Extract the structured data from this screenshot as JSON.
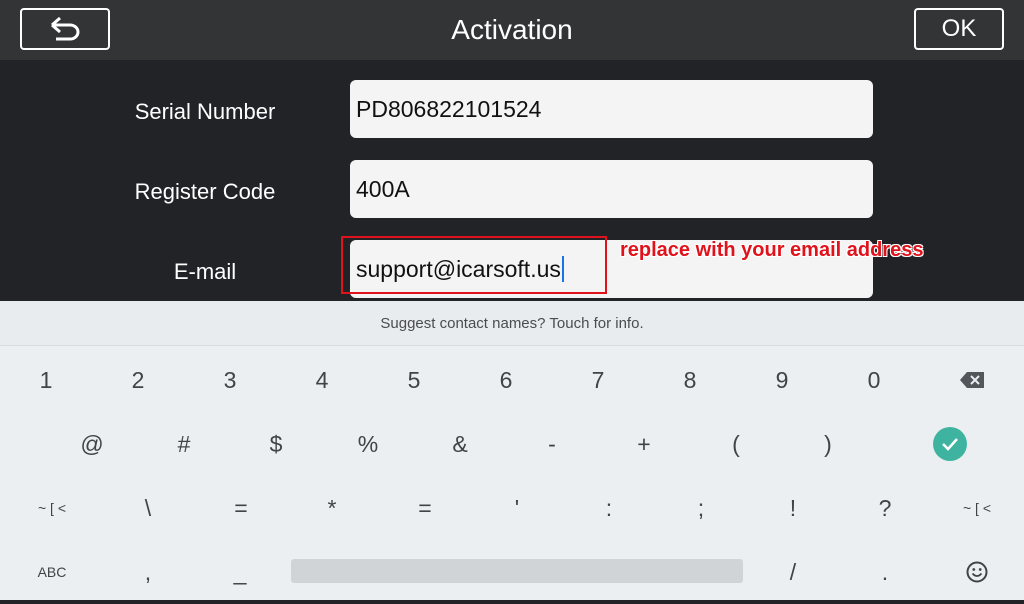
{
  "header": {
    "title": "Activation",
    "ok_label": "OK",
    "back_icon": "back-arrow-icon"
  },
  "form": {
    "serial_label": "Serial Number",
    "serial_value": "PD806822101524",
    "register_label": "Register Code",
    "register_value": "400A",
    "email_label": "E-mail",
    "email_value": "support@icarsoft.us",
    "annotation": "replace with your email address"
  },
  "keyboard": {
    "suggestion": "Suggest contact names? Touch for info.",
    "row1": [
      "1",
      "2",
      "3",
      "4",
      "5",
      "6",
      "7",
      "8",
      "9",
      "0"
    ],
    "row2": [
      "@",
      "#",
      "$",
      "%",
      "&",
      "-",
      "+",
      "(",
      ")"
    ],
    "row3_mode_left": "~ [ <",
    "row3": [
      "\\",
      "=",
      "*",
      "=",
      "'",
      ":",
      ";",
      "!",
      "?"
    ],
    "row3_mode_right": "~ [ <",
    "row4_abc": "ABC",
    "row4_keys": [
      ",",
      "_"
    ],
    "row4_right": [
      "/",
      "."
    ],
    "icons": {
      "backspace": "backspace-icon",
      "enter": "check-icon",
      "emoji": "emoji-icon"
    },
    "colors": {
      "enter_bg": "#3eb4a0",
      "annotation": "#e0121b"
    }
  }
}
